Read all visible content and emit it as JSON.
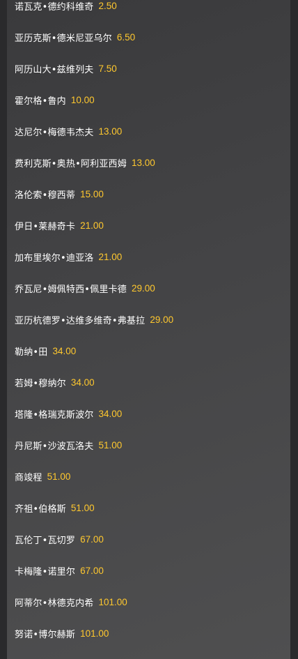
{
  "odds_list": [
    {
      "name": "诺瓦克•德约科维奇",
      "odds": "2.50"
    },
    {
      "name": "亚历克斯•德米尼亚乌尔",
      "odds": "6.50"
    },
    {
      "name": "阿历山大•兹维列夫",
      "odds": "7.50"
    },
    {
      "name": "霍尔格•鲁内",
      "odds": "10.00"
    },
    {
      "name": "达尼尔•梅德韦杰夫",
      "odds": "13.00"
    },
    {
      "name": "费利克斯•奥热•阿利亚西姆",
      "odds": "13.00"
    },
    {
      "name": "洛伦索•穆西蒂",
      "odds": "15.00"
    },
    {
      "name": "伊日•莱赫奇卡",
      "odds": "21.00"
    },
    {
      "name": "加布里埃尔•迪亚洛",
      "odds": "21.00"
    },
    {
      "name": "乔瓦尼•姆佩特西•佩里卡德",
      "odds": "29.00"
    },
    {
      "name": "亚历杭德罗•达维多维奇•弗基拉",
      "odds": "29.00"
    },
    {
      "name": "勒纳•田",
      "odds": "34.00"
    },
    {
      "name": "若姆•穆纳尔",
      "odds": "34.00"
    },
    {
      "name": "塔隆•格瑞克斯波尔",
      "odds": "34.00"
    },
    {
      "name": "丹尼斯•沙波瓦洛夫",
      "odds": "51.00"
    },
    {
      "name": "商竣程",
      "odds": "51.00"
    },
    {
      "name": "齐祖•伯格斯",
      "odds": "51.00"
    },
    {
      "name": "瓦伦丁•瓦切罗",
      "odds": "67.00"
    },
    {
      "name": "卡梅隆•诺里尔",
      "odds": "67.00"
    },
    {
      "name": "阿蒂尔•林德克内希",
      "odds": "101.00"
    },
    {
      "name": "努诺•博尔赫斯",
      "odds": "101.00"
    }
  ],
  "colors": {
    "odds": "#ffc82e",
    "name": "#ffffff",
    "panel": "#444446"
  }
}
